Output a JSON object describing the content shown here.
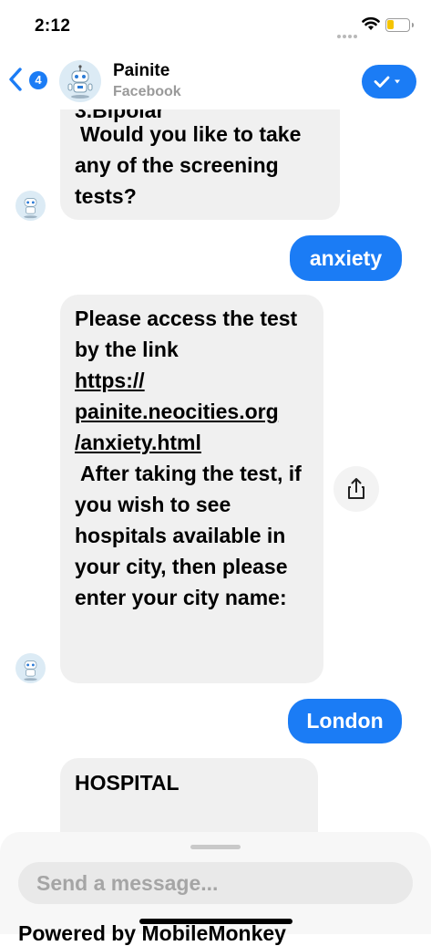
{
  "status_bar": {
    "time": "2:12"
  },
  "header": {
    "unread_count": "4",
    "title": "Painite",
    "subtitle": "Facebook"
  },
  "messages": [
    {
      "from": "bot",
      "text_partial": "3.Bipolar",
      "text": "Would you like to take any of the screening tests?"
    },
    {
      "from": "user",
      "text": "anxiety"
    },
    {
      "from": "bot",
      "text_pre": "Please access the test by the link",
      "link_lines": [
        "https://",
        "painite.neocities.org",
        "/anxiety.html"
      ],
      "text_post": "After taking the test, if you wish to see hospitals available in your city, then please enter your city name:"
    },
    {
      "from": "user",
      "text": "London"
    },
    {
      "from": "bot",
      "text": "HOSPITAL"
    }
  ],
  "composer": {
    "placeholder": "Send a message...",
    "powered_by": "Powered by MobileMonkey"
  },
  "colors": {
    "accent": "#1b7cf5",
    "bubble_in": "#f0f0f0"
  }
}
